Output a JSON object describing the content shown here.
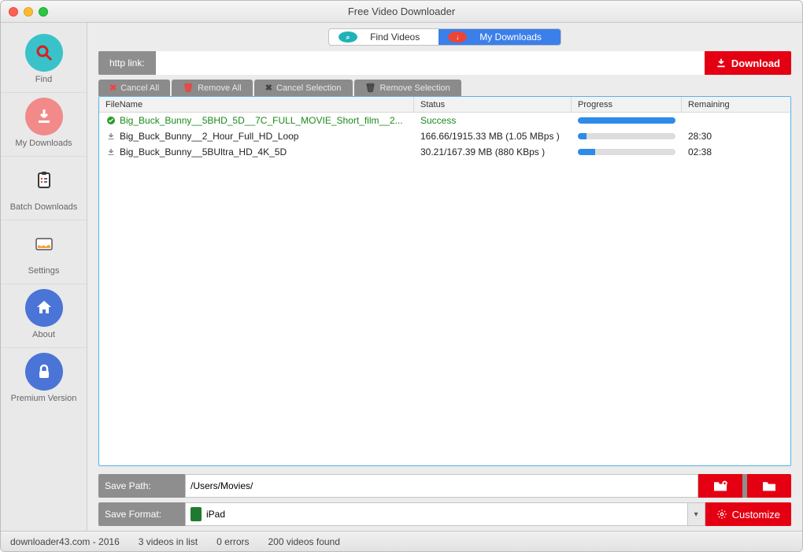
{
  "window": {
    "title": "Free Video Downloader"
  },
  "sidebar": {
    "items": [
      {
        "label": "Find"
      },
      {
        "label": "My Downloads"
      },
      {
        "label": "Batch Downloads"
      },
      {
        "label": "Settings"
      },
      {
        "label": "About"
      },
      {
        "label": "Premium Version"
      }
    ]
  },
  "tabs": {
    "find": "Find Videos",
    "downloads": "My Downloads"
  },
  "linkbar": {
    "label": "http link:",
    "value": "",
    "button": "Download"
  },
  "actions": {
    "cancel_all": "Cancel All",
    "remove_all": "Remove All",
    "cancel_selection": "Cancel Selection",
    "remove_selection": "Remove Selection"
  },
  "table": {
    "headers": {
      "file": "FileName",
      "status": "Status",
      "progress": "Progress",
      "remaining": "Remaining"
    },
    "rows": [
      {
        "file": "Big_Buck_Bunny__5BHD_5D__7C_FULL_MOVIE_Short_film__2...",
        "status": "Success",
        "progress": 100,
        "remaining": "",
        "success": true
      },
      {
        "file": "Big_Buck_Bunny__2_Hour_Full_HD_Loop",
        "status": "166.66/1915.33 MB (1.05 MBps )",
        "progress": 9,
        "remaining": "28:30",
        "success": false
      },
      {
        "file": "Big_Buck_Bunny__5BUltra_HD_4K_5D",
        "status": "30.21/167.39 MB (880 KBps )",
        "progress": 18,
        "remaining": "02:38",
        "success": false
      }
    ]
  },
  "save": {
    "path_label": "Save Path:",
    "path_value": "/Users/Movies/",
    "format_label": "Save Format:",
    "format_value": "iPad",
    "customize": "Customize"
  },
  "status": {
    "site": "downloader43.com - 2016",
    "vids": "3 videos in list",
    "errors": "0 errors",
    "found": "200 videos found"
  }
}
